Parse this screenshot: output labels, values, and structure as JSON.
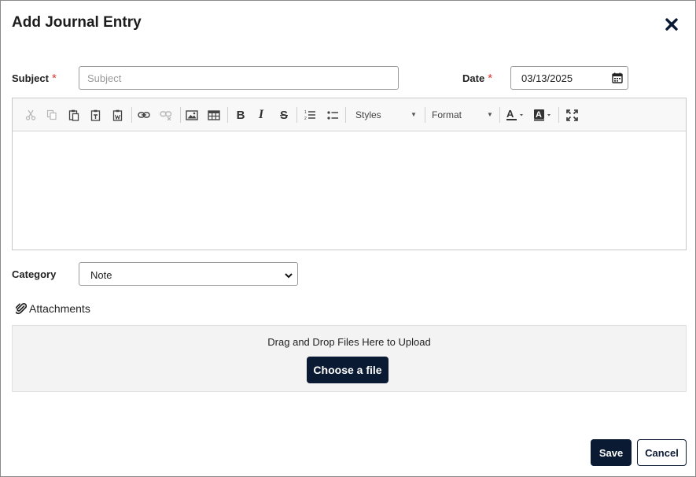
{
  "dialog": {
    "title": "Add Journal Entry",
    "close_icon": "close-icon"
  },
  "subject": {
    "label": "Subject",
    "required_mark": "*",
    "value": "",
    "placeholder": "Subject"
  },
  "date": {
    "label": "Date",
    "required_mark": "*",
    "value": "03/13/2025",
    "icon": "calendar-icon"
  },
  "toolbar": {
    "buttons": [
      "cut-icon",
      "copy-icon",
      "paste-icon",
      "paste-text-icon",
      "paste-word-icon",
      "link-icon",
      "unlink-icon",
      "image-icon",
      "table-icon",
      "bold-icon",
      "italic-icon",
      "strikethrough-icon",
      "numbered-list-icon",
      "bulleted-list-icon",
      "text-color-icon",
      "background-color-icon",
      "maximize-icon"
    ],
    "styles_label": "Styles",
    "format_label": "Format"
  },
  "category": {
    "label": "Category",
    "selected": "Note"
  },
  "attachments": {
    "label": "Attachments",
    "dropzone_text": "Drag and Drop Files Here to Upload",
    "choose_label": "Choose a file"
  },
  "actions": {
    "save_label": "Save",
    "cancel_label": "Cancel"
  },
  "colors": {
    "primary": "#0b1a33",
    "required": "#d9382f"
  }
}
